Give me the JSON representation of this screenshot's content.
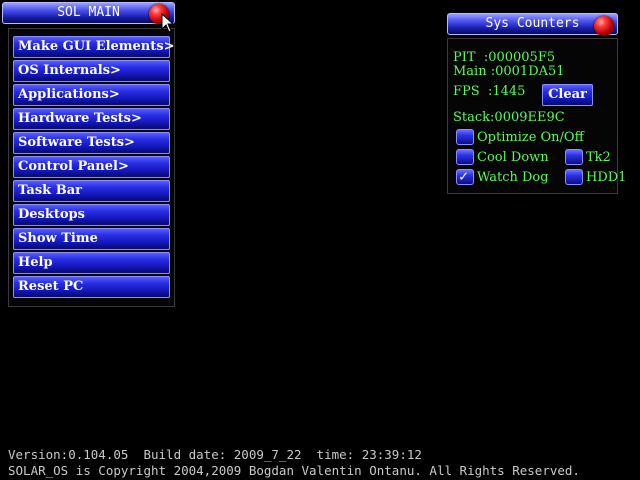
{
  "main_window": {
    "title": "SOL MAIN",
    "menu": [
      {
        "label": "Make GUI Elements>"
      },
      {
        "label": "OS Internals>"
      },
      {
        "label": "Applications>"
      },
      {
        "label": "Hardware Tests>"
      },
      {
        "label": "Software Tests>"
      },
      {
        "label": "Control Panel>"
      },
      {
        "label": "Task Bar"
      },
      {
        "label": "Desktops"
      },
      {
        "label": "Show Time"
      },
      {
        "label": "Help"
      },
      {
        "label": "Reset PC"
      }
    ]
  },
  "counters_window": {
    "title": "Sys Counters",
    "pit": "PIT  :000005F5",
    "main": "Main :0001DA51",
    "fps": "FPS  :1445",
    "clear_label": "Clear",
    "stack": "Stack:0009EE9C",
    "options": {
      "optimize": {
        "label": "Optimize On/Off",
        "checked": false
      },
      "cool_down": {
        "label": "Cool Down",
        "checked": false
      },
      "tk2": {
        "label": "Tk2",
        "checked": false
      },
      "watch_dog": {
        "label": "Watch Dog",
        "checked": true
      },
      "hdd1": {
        "label": "HDD1",
        "checked": false
      }
    }
  },
  "footer": {
    "version_line": "Version:0.104.05  Build date: 2009_7_22  time: 23:39:12",
    "copyright_line": "SOLAR_OS is Copyright 2004,2009 Bogdan Valentin Ontanu. All Rights Reserved."
  },
  "colors": {
    "background": "#000000",
    "counter_text": "#52ff52",
    "button_blue": "#1216b8",
    "close_red": "#ff3a3a",
    "footer_text": "#c8c8c8"
  },
  "icons": {
    "close": "red-ball-icon",
    "cursor": "mouse-pointer-icon",
    "check": "checkmark-icon"
  }
}
